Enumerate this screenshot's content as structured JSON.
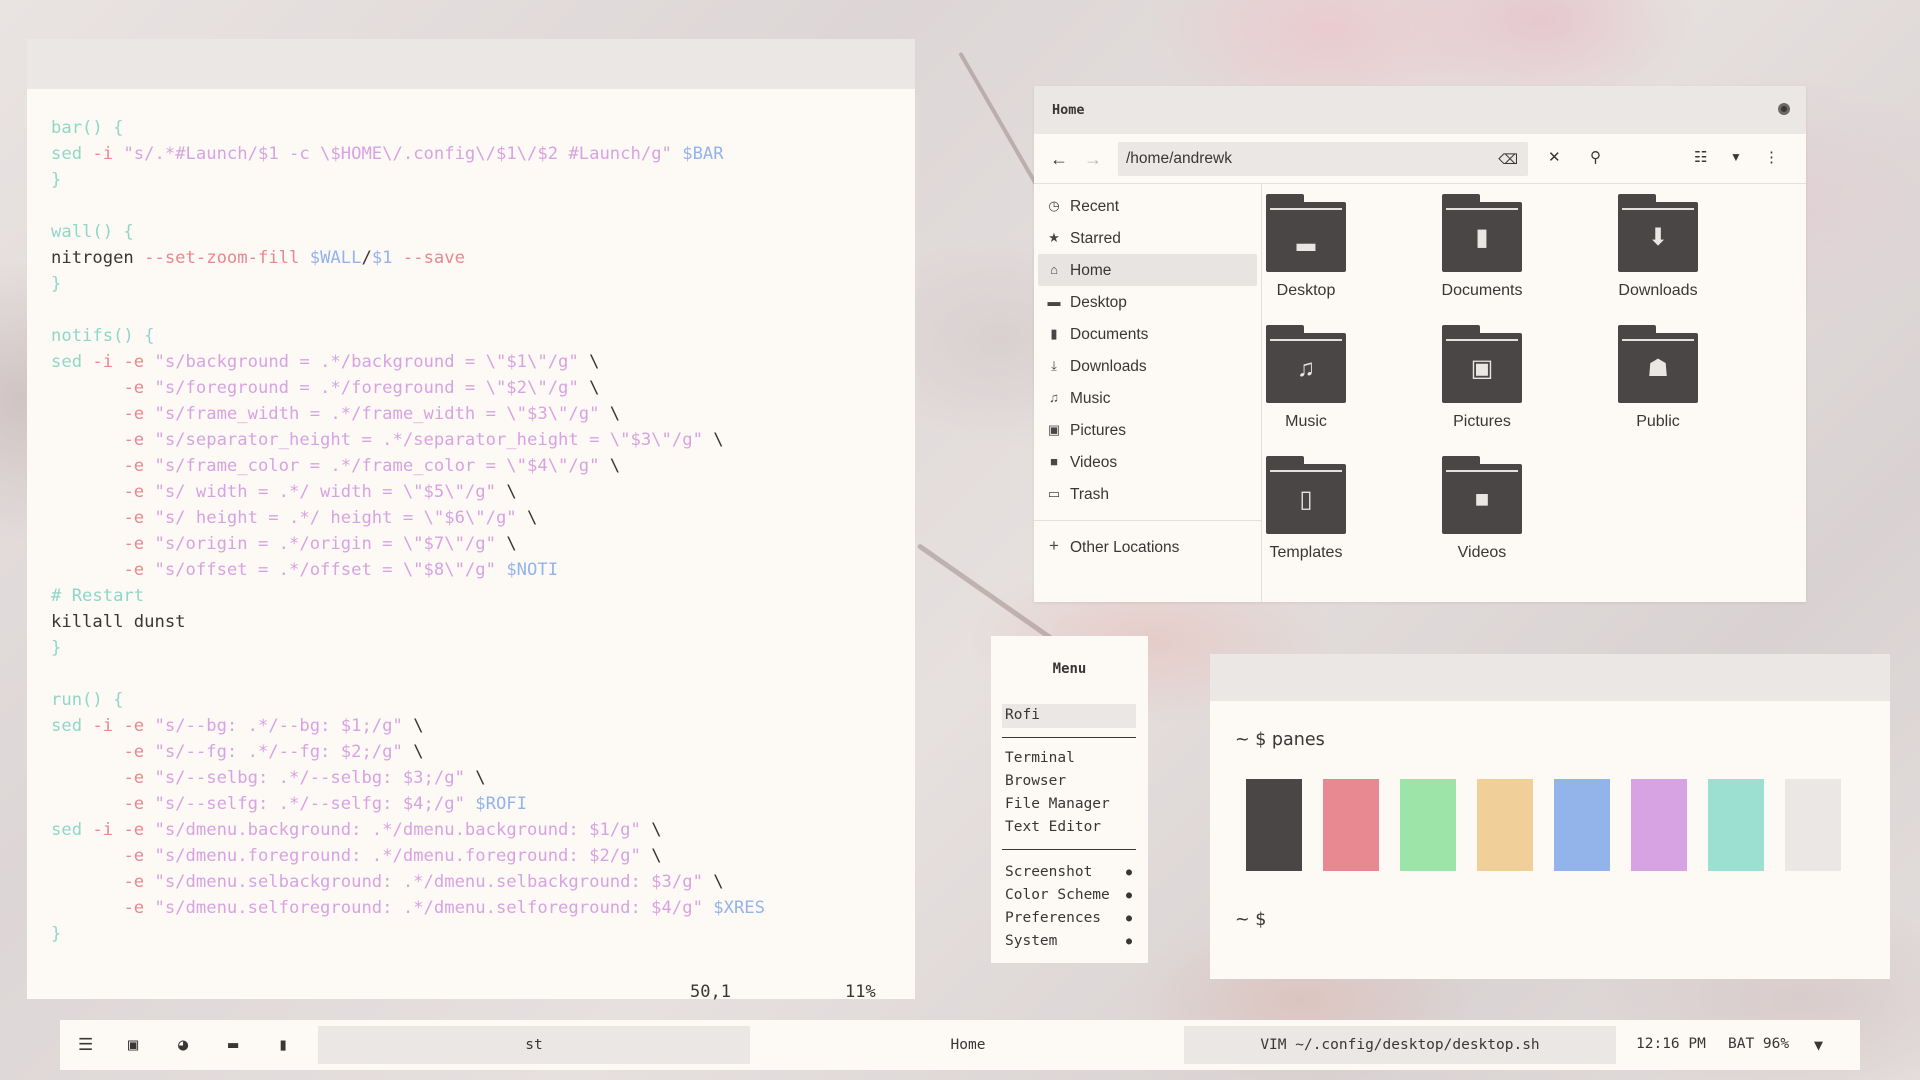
{
  "colors": {
    "black": "#4a4646",
    "red": "#e88890",
    "green": "#9de4a8",
    "yellow": "#f0cf98",
    "blue": "#93b4ea",
    "magenta": "#d8a3e2",
    "cyan": "#9ce0d2",
    "white": "#eae7e4",
    "background": "#fdf9f5",
    "foreground": "#3a3636"
  },
  "editor": {
    "lines": [
      [
        {
          "c": "t-fn",
          "t": "bar() {"
        }
      ],
      [
        {
          "c": "t-kw",
          "t": "sed "
        },
        {
          "c": "t-op",
          "t": "-i "
        },
        {
          "c": "t-str",
          "t": "\"s/.*#Launch/$1 -c \\$HOME\\/.config\\/$1\\/$2 #Launch/g\" "
        },
        {
          "c": "t-var",
          "t": "$BAR"
        }
      ],
      [
        {
          "c": "t-br",
          "t": "}"
        }
      ],
      [
        {
          "c": "t-plain",
          "t": ""
        }
      ],
      [
        {
          "c": "t-fn",
          "t": "wall() {"
        }
      ],
      [
        {
          "c": "t-plain",
          "t": "nitrogen "
        },
        {
          "c": "t-op",
          "t": "--set-zoom-fill "
        },
        {
          "c": "t-var",
          "t": "$WALL"
        },
        {
          "c": "t-plain",
          "t": "/"
        },
        {
          "c": "t-var",
          "t": "$1 "
        },
        {
          "c": "t-op",
          "t": "--save"
        }
      ],
      [
        {
          "c": "t-br",
          "t": "}"
        }
      ],
      [
        {
          "c": "t-plain",
          "t": ""
        }
      ],
      [
        {
          "c": "t-fn",
          "t": "notifs() {"
        }
      ],
      [
        {
          "c": "t-kw",
          "t": "sed "
        },
        {
          "c": "t-op",
          "t": "-i -e "
        },
        {
          "c": "t-str",
          "t": "\"s/background = .*/background = \\\"$1\\\"/g\" "
        },
        {
          "c": "t-plain",
          "t": "\\"
        }
      ],
      [
        {
          "c": "t-plain",
          "t": "       "
        },
        {
          "c": "t-op",
          "t": "-e "
        },
        {
          "c": "t-str",
          "t": "\"s/foreground = .*/foreground = \\\"$2\\\"/g\" "
        },
        {
          "c": "t-plain",
          "t": "\\"
        }
      ],
      [
        {
          "c": "t-plain",
          "t": "       "
        },
        {
          "c": "t-op",
          "t": "-e "
        },
        {
          "c": "t-str",
          "t": "\"s/frame_width = .*/frame_width = \\\"$3\\\"/g\" "
        },
        {
          "c": "t-plain",
          "t": "\\"
        }
      ],
      [
        {
          "c": "t-plain",
          "t": "       "
        },
        {
          "c": "t-op",
          "t": "-e "
        },
        {
          "c": "t-str",
          "t": "\"s/separator_height = .*/separator_height = \\\"$3\\\"/g\" "
        },
        {
          "c": "t-plain",
          "t": "\\"
        }
      ],
      [
        {
          "c": "t-plain",
          "t": "       "
        },
        {
          "c": "t-op",
          "t": "-e "
        },
        {
          "c": "t-str",
          "t": "\"s/frame_color = .*/frame_color = \\\"$4\\\"/g\" "
        },
        {
          "c": "t-plain",
          "t": "\\"
        }
      ],
      [
        {
          "c": "t-plain",
          "t": "       "
        },
        {
          "c": "t-op",
          "t": "-e "
        },
        {
          "c": "t-str",
          "t": "\"s/ width = .*/ width = \\\"$5\\\"/g\" "
        },
        {
          "c": "t-plain",
          "t": "\\"
        }
      ],
      [
        {
          "c": "t-plain",
          "t": "       "
        },
        {
          "c": "t-op",
          "t": "-e "
        },
        {
          "c": "t-str",
          "t": "\"s/ height = .*/ height = \\\"$6\\\"/g\" "
        },
        {
          "c": "t-plain",
          "t": "\\"
        }
      ],
      [
        {
          "c": "t-plain",
          "t": "       "
        },
        {
          "c": "t-op",
          "t": "-e "
        },
        {
          "c": "t-str",
          "t": "\"s/origin = .*/origin = \\\"$7\\\"/g\" "
        },
        {
          "c": "t-plain",
          "t": "\\"
        }
      ],
      [
        {
          "c": "t-plain",
          "t": "       "
        },
        {
          "c": "t-op",
          "t": "-e "
        },
        {
          "c": "t-str",
          "t": "\"s/offset = .*/offset = \\\"$8\\\"/g\" "
        },
        {
          "c": "t-var",
          "t": "$NOTI"
        }
      ],
      [
        {
          "c": "t-cm",
          "t": "# Restart"
        }
      ],
      [
        {
          "c": "t-plain",
          "t": "killall dunst"
        }
      ],
      [
        {
          "c": "t-br",
          "t": "}"
        }
      ],
      [
        {
          "c": "t-plain",
          "t": ""
        }
      ],
      [
        {
          "c": "t-fn",
          "t": "run() {"
        }
      ],
      [
        {
          "c": "t-kw",
          "t": "sed "
        },
        {
          "c": "t-op",
          "t": "-i -e "
        },
        {
          "c": "t-str",
          "t": "\"s/--bg: .*/--bg: $1;/g\" "
        },
        {
          "c": "t-plain",
          "t": "\\"
        }
      ],
      [
        {
          "c": "t-plain",
          "t": "       "
        },
        {
          "c": "t-op",
          "t": "-e "
        },
        {
          "c": "t-str",
          "t": "\"s/--fg: .*/--fg: $2;/g\" "
        },
        {
          "c": "t-plain",
          "t": "\\"
        }
      ],
      [
        {
          "c": "t-plain",
          "t": "       "
        },
        {
          "c": "t-op",
          "t": "-e "
        },
        {
          "c": "t-str",
          "t": "\"s/--selbg: .*/--selbg: $3;/g\" "
        },
        {
          "c": "t-plain",
          "t": "\\"
        }
      ],
      [
        {
          "c": "t-plain",
          "t": "       "
        },
        {
          "c": "t-op",
          "t": "-e "
        },
        {
          "c": "t-str",
          "t": "\"s/--selfg: .*/--selfg: $4;/g\" "
        },
        {
          "c": "t-var",
          "t": "$ROFI"
        }
      ],
      [
        {
          "c": "t-kw",
          "t": "sed "
        },
        {
          "c": "t-op",
          "t": "-i -e "
        },
        {
          "c": "t-str",
          "t": "\"s/dmenu.background: .*/dmenu.background: $1/g\" "
        },
        {
          "c": "t-plain",
          "t": "\\"
        }
      ],
      [
        {
          "c": "t-plain",
          "t": "       "
        },
        {
          "c": "t-op",
          "t": "-e "
        },
        {
          "c": "t-str",
          "t": "\"s/dmenu.foreground: .*/dmenu.foreground: $2/g\" "
        },
        {
          "c": "t-plain",
          "t": "\\"
        }
      ],
      [
        {
          "c": "t-plain",
          "t": "       "
        },
        {
          "c": "t-op",
          "t": "-e "
        },
        {
          "c": "t-str",
          "t": "\"s/dmenu.selbackground: .*/dmenu.selbackground: $3/g\" "
        },
        {
          "c": "t-plain",
          "t": "\\"
        }
      ],
      [
        {
          "c": "t-plain",
          "t": "       "
        },
        {
          "c": "t-op",
          "t": "-e "
        },
        {
          "c": "t-str",
          "t": "\"s/dmenu.selforeground: .*/dmenu.selforeground: $4/g\" "
        },
        {
          "c": "t-var",
          "t": "$XRES"
        }
      ],
      [
        {
          "c": "t-br",
          "t": "}"
        }
      ]
    ],
    "status_position": "50,1",
    "status_percent": "11%"
  },
  "files": {
    "title": "Home",
    "path": "/home/andrewk",
    "sidebar": [
      {
        "label": "Recent",
        "icon": "clock-icon",
        "glyph": "◷"
      },
      {
        "label": "Starred",
        "icon": "star-icon",
        "glyph": "★"
      },
      {
        "label": "Home",
        "icon": "home-icon",
        "glyph": "⌂",
        "active": true
      },
      {
        "label": "Desktop",
        "icon": "desktop-icon",
        "glyph": "▬"
      },
      {
        "label": "Documents",
        "icon": "document-icon",
        "glyph": "▮"
      },
      {
        "label": "Downloads",
        "icon": "download-icon",
        "glyph": "⤓"
      },
      {
        "label": "Music",
        "icon": "music-icon",
        "glyph": "♫"
      },
      {
        "label": "Pictures",
        "icon": "picture-icon",
        "glyph": "▣"
      },
      {
        "label": "Videos",
        "icon": "video-icon",
        "glyph": "■"
      },
      {
        "label": "Trash",
        "icon": "trash-icon",
        "glyph": "▭"
      }
    ],
    "other_locations": "Other Locations",
    "folders": [
      {
        "label": "Desktop",
        "icon": "desktop-folder-icon",
        "glyph": "▂"
      },
      {
        "label": "Documents",
        "icon": "documents-folder-icon",
        "glyph": "▮"
      },
      {
        "label": "Downloads",
        "icon": "downloads-folder-icon",
        "glyph": "⬇"
      },
      {
        "label": "Music",
        "icon": "music-folder-icon",
        "glyph": "♫"
      },
      {
        "label": "Pictures",
        "icon": "pictures-folder-icon",
        "glyph": "▣"
      },
      {
        "label": "Public",
        "icon": "public-folder-icon",
        "glyph": "☗"
      },
      {
        "label": "Templates",
        "icon": "templates-folder-icon",
        "glyph": "▯"
      },
      {
        "label": "Videos",
        "icon": "videos-folder-icon",
        "glyph": "■"
      }
    ]
  },
  "menu": {
    "title": "Menu",
    "input": "Rofi",
    "apps": [
      "Terminal",
      "Browser",
      "File Manager",
      "Text Editor"
    ],
    "submenus": [
      "Screenshot",
      "Color Scheme",
      "Preferences",
      "System"
    ]
  },
  "terminal": {
    "prompt1": "~ $ panes",
    "prompt2": "~ $"
  },
  "taskbar": {
    "tasks": [
      "st",
      "Home",
      "VIM ~/.config/desktop/desktop.sh"
    ],
    "time": "12:16 PM",
    "battery": "BAT 96%"
  }
}
